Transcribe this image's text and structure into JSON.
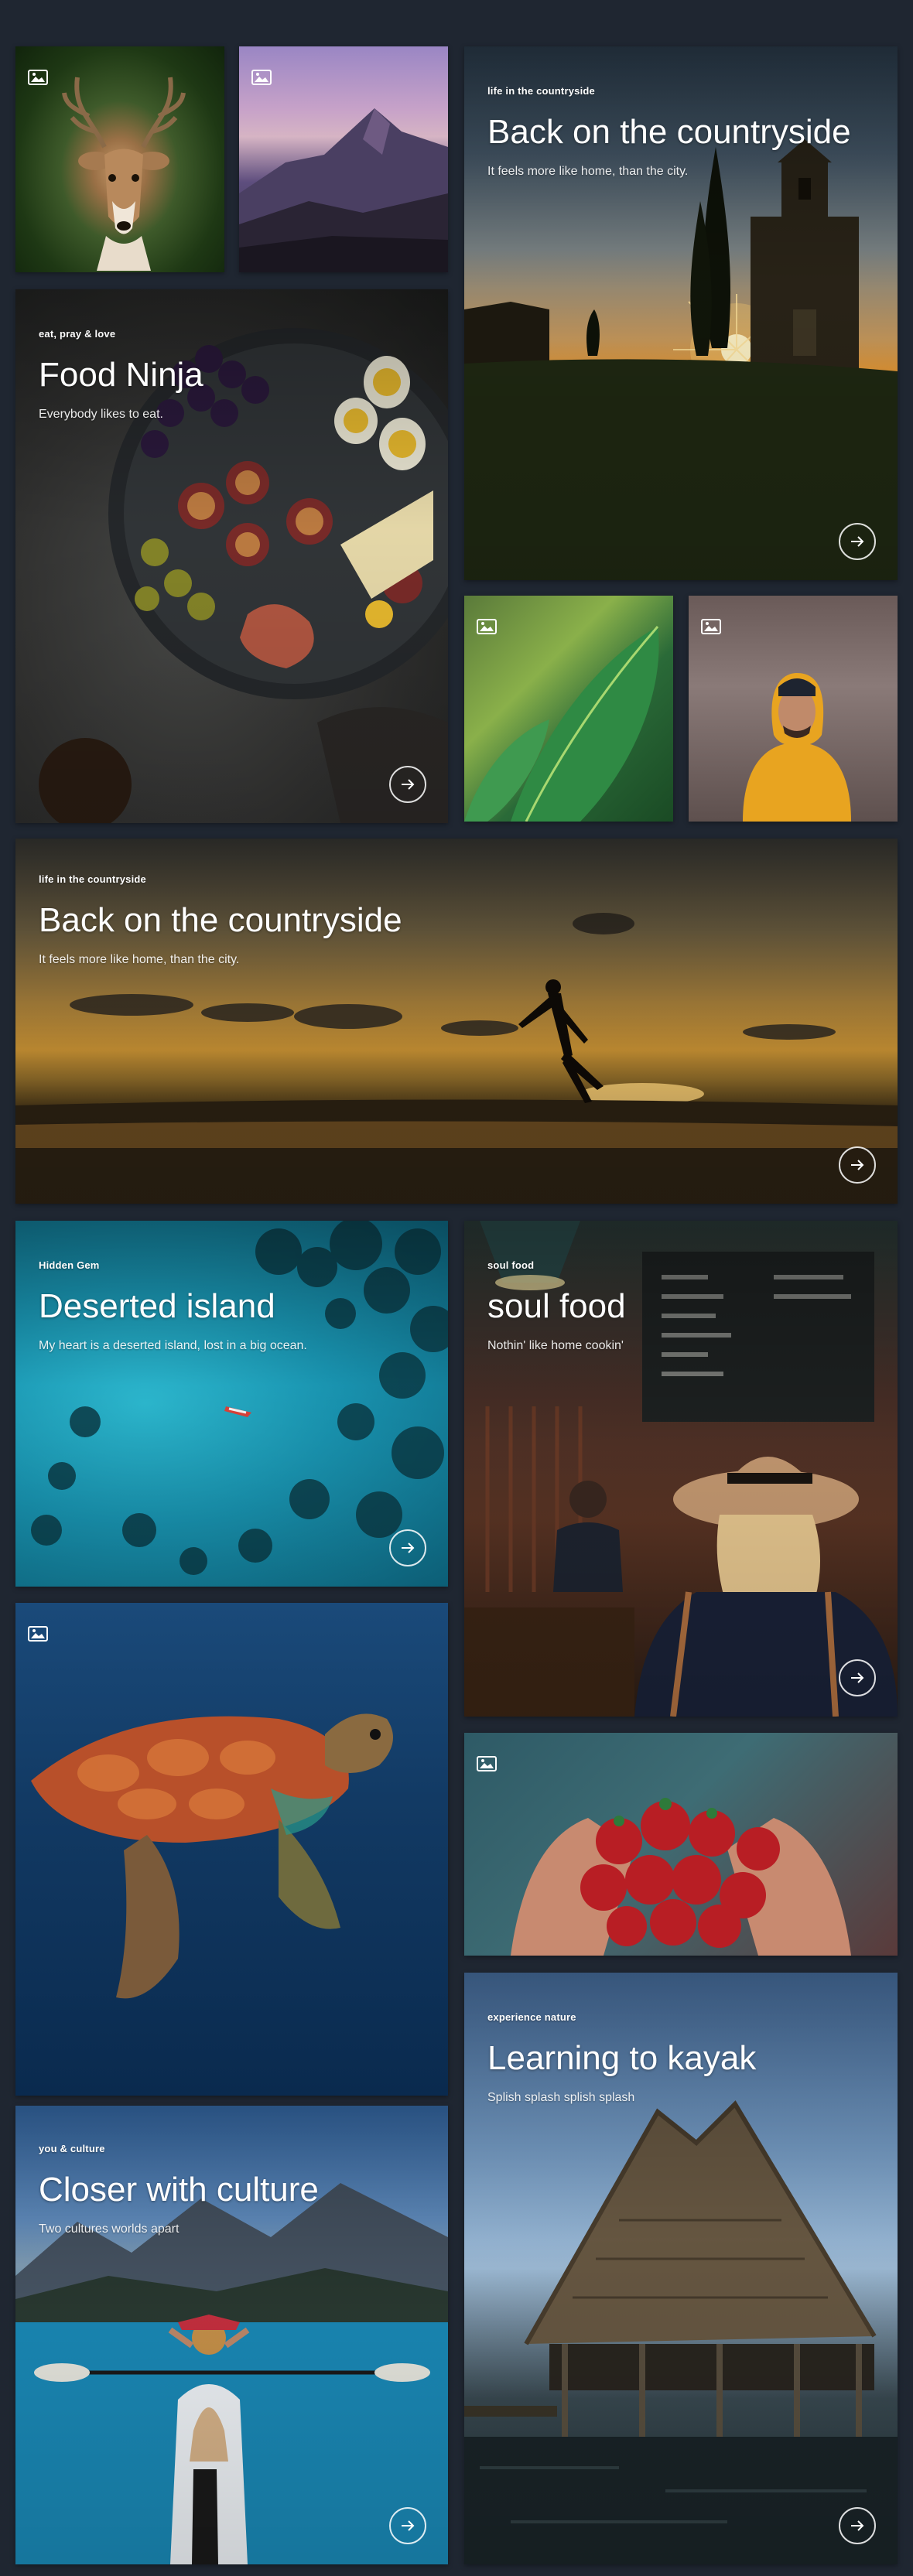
{
  "tiles": {
    "countryside_1": {
      "eyebrow": "life in the countryside",
      "title": "Back on the countryside",
      "subtitle": "It feels more like home, than the city."
    },
    "food_ninja": {
      "eyebrow": "eat, pray & love",
      "title": "Food Ninja",
      "subtitle": "Everybody likes to eat."
    },
    "countryside_2": {
      "eyebrow": "life in the countryside",
      "title": "Back on the countryside",
      "subtitle": "It feels more like home, than the city."
    },
    "deserted_island": {
      "eyebrow": "Hidden Gem",
      "title": "Deserted island",
      "subtitle": "My heart is a deserted island, lost in a big ocean."
    },
    "soul_food": {
      "eyebrow": "soul food",
      "title": "soul food",
      "subtitle": "Nothin' like home cookin'"
    },
    "kayak": {
      "eyebrow": "experience nature",
      "title": "Learning to kayak",
      "subtitle": "Splish splash splish splash"
    },
    "culture": {
      "eyebrow": "you & culture",
      "title": "Closer with culture",
      "subtitle": "Two cultures worlds apart"
    }
  },
  "icons": {
    "image_badge": "image-icon",
    "link_arrow": "arrow-right-circle-icon"
  },
  "colors": {
    "page_background": "#1f2631"
  }
}
